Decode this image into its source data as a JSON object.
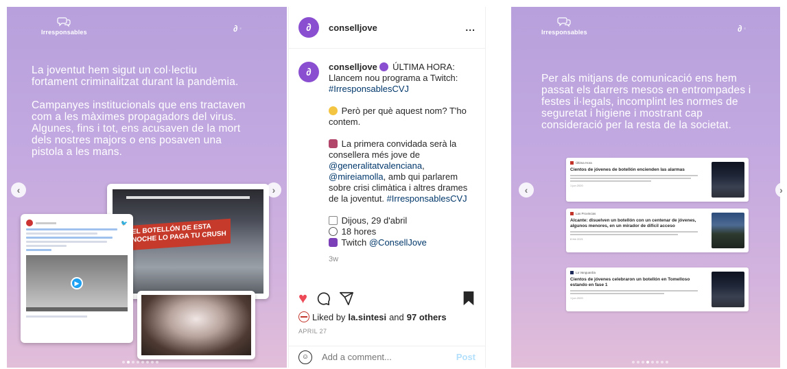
{
  "left_story": {
    "brand": "Irresponsables",
    "paragraphs": [
      "La joventut hem sigut un col·lectiu fortament criminalitzat durant la pandèmia.",
      "Campanyes institucionals que ens tractaven com a les màximes propagadors del virus. Algunes, fins i tot, ens acusaven de la mort dels nostres majors o ens posaven una pistola a les mans."
    ],
    "metro_banner": "EL BOTELLÓN DE ESTA NOCHE LO PAGA TU CRUSH"
  },
  "post": {
    "username": "conselljove",
    "more": "...",
    "caption_user": "conselljove",
    "caption_line1": "ÚLTIMA HORA: Llancem nou programa a Twitch:",
    "hashtag1": "#IrresponsablesCVJ",
    "p2": "Però per què aquest nom? T'ho contem.",
    "p3_text": "La primera convidada serà la consellera més jove de",
    "mention1": "@generalitatvalenciana",
    "mention2": "@mireiamolla",
    "p3_rest": ", amb qui parlarem sobre crisi climàtica i altres drames de la joventut.",
    "hashtag2": "#IrresponsablesCVJ",
    "date_line": "Dijous, 29 d'abril",
    "hour_line": "18 hores",
    "twitch_label": "Twitch",
    "twitch_handle": "@ConsellJove",
    "time_ago": "3w",
    "liked_prefix": "Liked by",
    "liked_user": "la.sintesi",
    "liked_and": "and",
    "liked_others": "97 others",
    "post_date": "APRIL 27",
    "comment_placeholder": "Add a comment...",
    "post_button": "Post"
  },
  "right_story": {
    "brand": "Irresponsables",
    "text": "Per als mitjans de comunicació ens hem passat els darrers mesos en entrompades i festes il·legals, incomplint les normes de seguretat i higiene i mostrant cap consideració per la resta de la societat.",
    "news": [
      {
        "source": "Última Hora",
        "headline": "Cientos de jóvenes de botellón encienden las alarmas",
        "date": "1 jun 2020"
      },
      {
        "source": "Las Provincias",
        "headline": "Alcante: disuelven un botellón con un centenar de jóvenes, algunos menores, en un mirador de difícil acceso",
        "date": "8 feb 2021"
      },
      {
        "source": "La Vanguardia",
        "headline": "Cientos de jóvenes celebraron un botellón en Tomelloso estando en fase 1",
        "date": "1 jun 2020"
      }
    ]
  },
  "colors": {
    "story_gradient_top": "#b7a0dc",
    "story_gradient_bottom": "#e2bed9",
    "instagram_like": "#ed4956",
    "instagram_link": "#00376b",
    "brand_purple": "#8a4fd0"
  }
}
